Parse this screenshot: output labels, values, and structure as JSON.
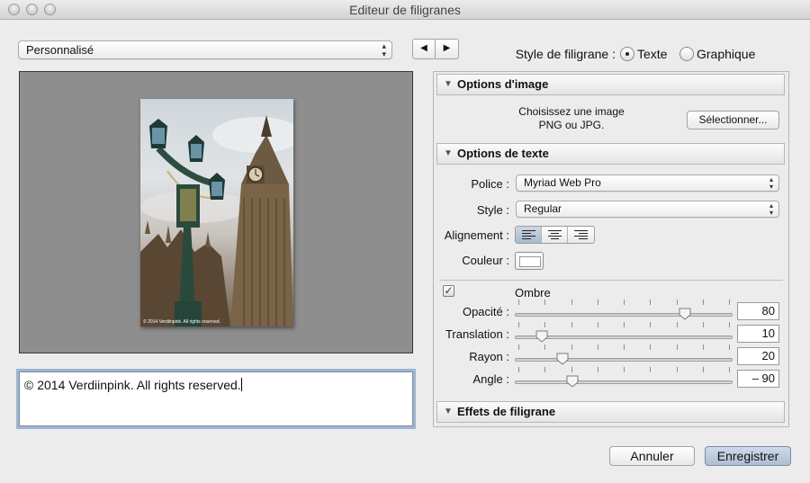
{
  "window": {
    "title": "Editeur de filigranes"
  },
  "preset": {
    "selected": "Personnalisé"
  },
  "style": {
    "label": "Style de filigrane :",
    "text_option": "Texte",
    "graphic_option": "Graphique",
    "selected": "Texte"
  },
  "preview": {
    "watermark_text": "© 2014 Verdiinpink. All rights reserved."
  },
  "text_input": {
    "value": "© 2014 Verdiinpink. All rights reserved."
  },
  "image_options": {
    "header": "Options d'image",
    "hint_line1": "Choisissez une image",
    "hint_line2": "PNG ou JPG.",
    "select_button": "Sélectionner..."
  },
  "text_options": {
    "header": "Options de texte",
    "font_label": "Police :",
    "font_value": "Myriad Web Pro",
    "style_label": "Style :",
    "style_value": "Regular",
    "align_label": "Alignement :",
    "color_label": "Couleur :"
  },
  "shadow": {
    "label": "Ombre",
    "checked": true,
    "opacity": {
      "label": "Opacité :",
      "value": "80",
      "fraction": 0.8
    },
    "offset": {
      "label": "Translation :",
      "value": "10",
      "fraction": 0.1
    },
    "radius": {
      "label": "Rayon :",
      "value": "20",
      "fraction": 0.2
    },
    "angle": {
      "label": "Angle :",
      "value": "– 90",
      "fraction": 0.25
    }
  },
  "effects": {
    "header": "Effets de filigrane"
  },
  "footer": {
    "cancel": "Annuler",
    "save": "Enregistrer"
  },
  "colors": {
    "preview_bg": "#8e8e8e",
    "focus_ring": "#9ab6d8",
    "save_button": "#b9c7db"
  }
}
